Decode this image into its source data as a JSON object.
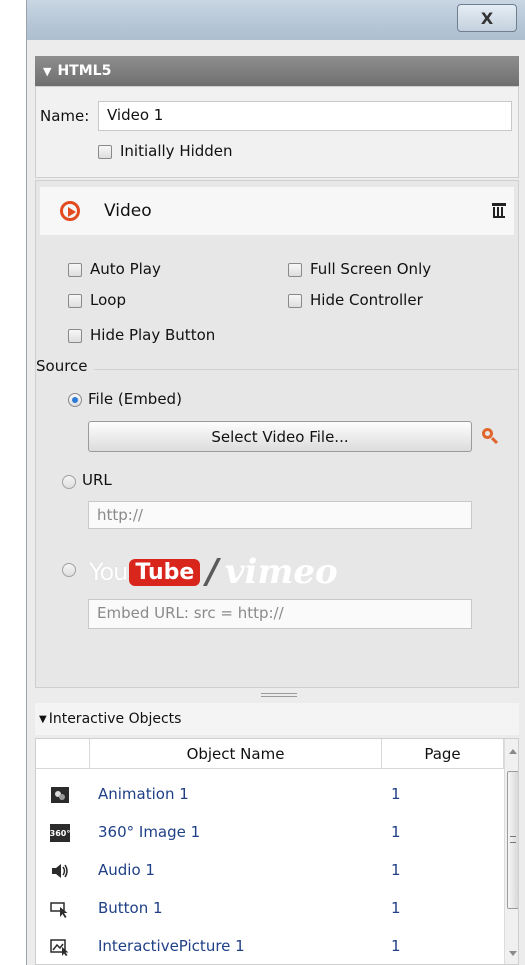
{
  "window": {
    "close_label": "X"
  },
  "section": {
    "title": "HTML5"
  },
  "general": {
    "name_label": "Name:",
    "name_value": "Video 1",
    "initially_hidden_label": "Initially Hidden"
  },
  "video": {
    "header_label": "Video",
    "options": {
      "auto_play": "Auto Play",
      "full_screen_only": "Full Screen Only",
      "loop": "Loop",
      "hide_controller": "Hide Controller",
      "hide_play_button": "Hide Play Button"
    },
    "source_label": "Source",
    "file_embed_label": "File (Embed)",
    "select_file_label": "Select Video File...",
    "url_label": "URL",
    "url_placeholder": "http://",
    "youtube_you": "You",
    "youtube_tube": "Tube",
    "slash": "/",
    "vimeo": "vimeo",
    "embed_placeholder": "Embed URL: src = http://",
    "selected_source": "file",
    "accent_color": "#e24b1f"
  },
  "interactive_objects": {
    "title": "Interactive Objects",
    "columns": {
      "name": "Object Name",
      "page": "Page"
    },
    "rows": [
      {
        "icon": "animation-icon",
        "name": "Animation 1",
        "page": "1"
      },
      {
        "icon": "360-image-icon",
        "icon_text": "360°",
        "name": "360° Image 1",
        "page": "1"
      },
      {
        "icon": "audio-icon",
        "name": "Audio 1",
        "page": "1"
      },
      {
        "icon": "button-icon",
        "name": "Button 1",
        "page": "1"
      },
      {
        "icon": "interactive-picture-icon",
        "name": "InteractivePicture 1",
        "page": "1"
      }
    ]
  }
}
